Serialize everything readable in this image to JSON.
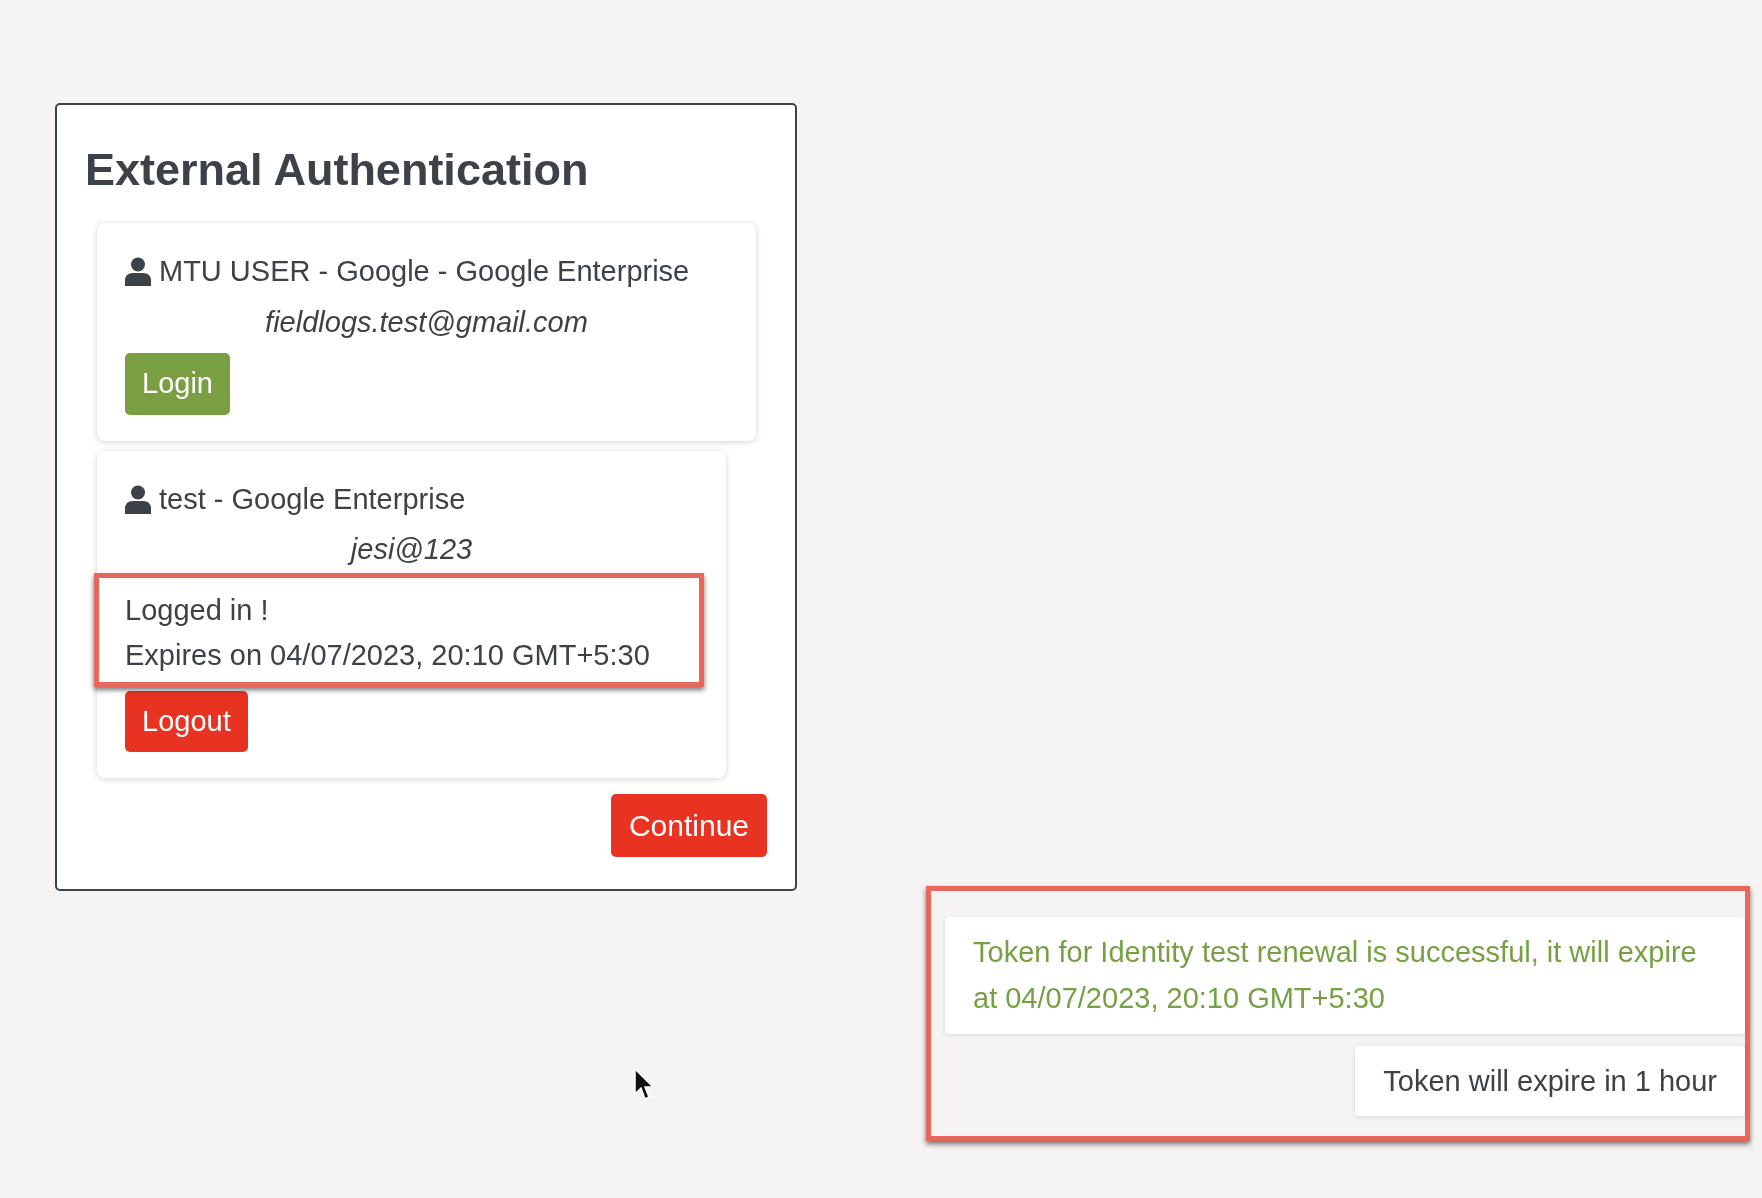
{
  "dialog": {
    "title": "External Authentication",
    "identities": [
      {
        "name": "MTU USER - Google - Google Enterprise",
        "email": "fieldlogs.test@gmail.com",
        "logged_in": false,
        "action": "Login"
      },
      {
        "name": "test - Google Enterprise",
        "email": "jesi@123",
        "logged_in": true,
        "status": "Logged in !",
        "expiry": "Expires on 04/07/2023, 20:10 GMT+5:30",
        "action": "Logout",
        "highlighted": true
      }
    ],
    "continue_button": "Continue"
  },
  "toasts_highlighted": true,
  "toasts": [
    {
      "kind": "success",
      "message": "Token for Identity test renewal is successful, it will expire at 04/07/2023, 20:10 GMT+5:30"
    },
    {
      "kind": "info",
      "message": "Token will expire in 1 hour"
    }
  ]
}
